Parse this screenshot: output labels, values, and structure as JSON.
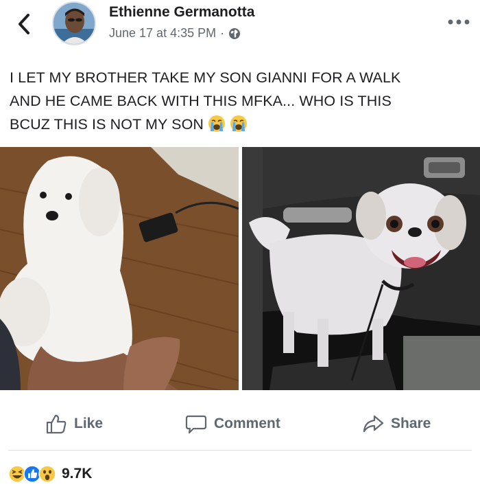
{
  "post": {
    "author": "Ethienne Germanotta",
    "timestamp": "June 17 at 4:35 PM",
    "separator": "·",
    "text_line1": "I LET MY BROTHER TAKE MY SON GIANNI FOR A WALK",
    "text_line2": "AND HE CAME BACK WITH THIS MFKA... WHO IS THIS",
    "text_line3": "BCUZ THIS IS NOT MY SON",
    "text_emojis": [
      "crying-face-emoji",
      "crying-face-emoji"
    ]
  },
  "header": {
    "back_icon": "chevron-left-icon",
    "privacy_icon": "globe-icon",
    "more_icon": "more-dots-icon"
  },
  "photos": [
    {
      "subject": "fluffy white dog before haircut"
    },
    {
      "subject": "shaved white dog after haircut in car"
    }
  ],
  "actions": {
    "like": "Like",
    "comment": "Comment",
    "share": "Share"
  },
  "reactions": {
    "icons": [
      "haha-icon",
      "like-reaction-icon",
      "wow-icon"
    ],
    "count": "9.7K"
  },
  "colors": {
    "text": "#1c1e21",
    "secondary": "#606770",
    "like_blue": "#1877f2",
    "reaction_yellow": "#f7c843"
  }
}
